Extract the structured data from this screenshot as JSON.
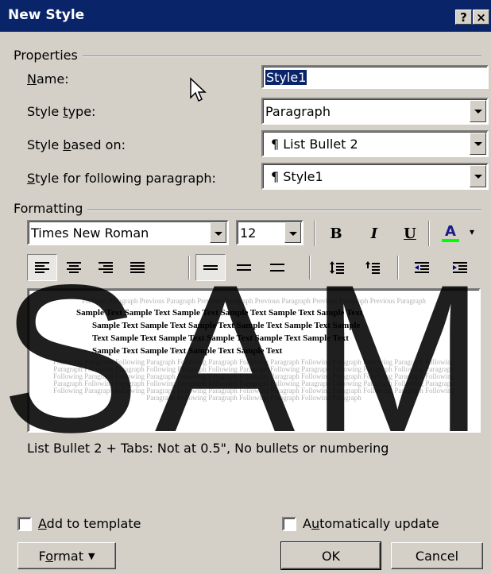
{
  "window": {
    "title": "New Style",
    "help_label": "?",
    "close_label": "×"
  },
  "properties": {
    "group_label": "Properties",
    "name": {
      "label": "Name:",
      "value": "Style1"
    },
    "style_type": {
      "label": "Style type:",
      "value": "Paragraph"
    },
    "based_on": {
      "label": "Style based on:",
      "value": "List Bullet 2"
    },
    "following": {
      "label": "Style for following paragraph:",
      "value": "Style1"
    }
  },
  "formatting": {
    "group_label": "Formatting",
    "font": "Times New Roman",
    "size": "12",
    "bold_label": "B",
    "italic_label": "I",
    "underline_label": "U",
    "font_color_label": "A",
    "font_color": "#00ff00"
  },
  "preview": {
    "previous_text": "Previous Paragraph Previous Paragraph Previous Paragraph Previous Paragraph Previous Paragraph Previous Paragraph",
    "sample_lines": [
      "Sample Text Sample Text Sample Text Sample Text Sample Text Sample Text",
      "Sample Text Sample Text Sample Text Sample Text Sample Text Sample",
      "Text Sample Text Sample Text Sample Text Sample Text Sample Text",
      "Sample Text Sample Text Sample Text Sample Text"
    ],
    "following_text": "Following Paragraph Following Paragraph Following Paragraph Following Paragraph Following Paragraph Following Paragraph Following Paragraph Following Paragraph Following Paragraph Following Paragraph Following Paragraph Following Paragraph Following Paragraph Following Paragraph Following Paragraph Following Paragraph Following Paragraph Following Paragraph Following Paragraph Following Paragraph Following Paragraph Following Paragraph Following Paragraph Following Paragraph Following Paragraph Following Paragraph Following Paragraph Following Paragraph Following Paragraph Following Paragraph Following Paragraph Following Paragraph Following Paragraph Following Paragraph Following Paragraph Following Paragraph"
  },
  "description": "List Bullet 2 + Tabs: Not at  0.5\",  No bullets or numbering",
  "options": {
    "add_to_template": {
      "label": "Add to template",
      "checked": false
    },
    "auto_update": {
      "label": "Automatically update",
      "checked": false
    }
  },
  "buttons": {
    "format": "Format",
    "ok": "OK",
    "cancel": "Cancel"
  },
  "watermark": "SAM"
}
